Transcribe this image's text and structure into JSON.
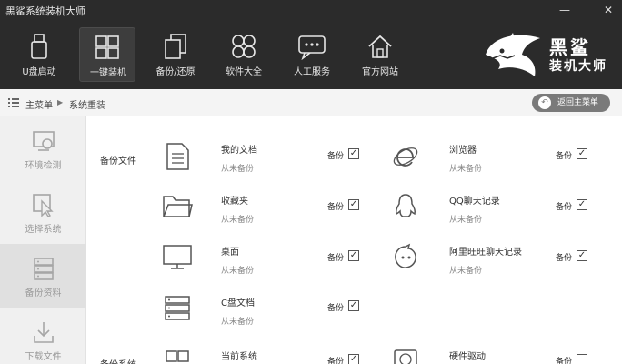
{
  "window": {
    "title": "黑鲨系统装机大师",
    "minimize_icon": "—",
    "close_icon": "✕"
  },
  "nav": [
    {
      "label": "U盘启动",
      "icon": "usb-drive-icon"
    },
    {
      "label": "一键装机",
      "icon": "windows-icon",
      "active": true
    },
    {
      "label": "备份/还原",
      "icon": "backup-restore-icon"
    },
    {
      "label": "软件大全",
      "icon": "apps-grid-icon"
    },
    {
      "label": "人工服务",
      "icon": "chat-icon"
    },
    {
      "label": "官方网站",
      "icon": "home-icon"
    }
  ],
  "logo": {
    "line1": "黑鲨",
    "line2": "装机大师",
    "icon": "shark-logo-icon"
  },
  "breadcrumb": {
    "home": "主菜单",
    "current": "系统重装",
    "separator": "▶"
  },
  "back_button": {
    "label": "返回主菜单",
    "arrow": "↶"
  },
  "sidebar": [
    {
      "label": "环境检测",
      "icon": "environment-check-icon"
    },
    {
      "label": "选择系统",
      "icon": "select-system-icon"
    },
    {
      "label": "备份资料",
      "icon": "backup-data-icon",
      "active": true
    },
    {
      "label": "下载文件",
      "icon": "download-file-icon"
    }
  ],
  "sections": {
    "backup_files": "备份文件",
    "backup_system": "备份系统"
  },
  "backup_label": "备份",
  "check_glyph": "✓",
  "items_left": [
    {
      "title": "我的文档",
      "status": "从未备份",
      "checked": true,
      "icon": "document-icon"
    },
    {
      "title": "收藏夹",
      "status": "从未备份",
      "checked": true,
      "icon": "folder-icon"
    },
    {
      "title": "桌面",
      "status": "从未备份",
      "checked": true,
      "icon": "monitor-icon"
    },
    {
      "title": "C盘文档",
      "status": "从未备份",
      "checked": true,
      "icon": "drive-stack-icon"
    },
    {
      "title": "当前系统",
      "status": "",
      "checked": true,
      "icon": "windows-icon"
    }
  ],
  "items_right": [
    {
      "title": "浏览器",
      "status": "从未备份",
      "checked": true,
      "icon": "ie-browser-icon"
    },
    {
      "title": "QQ聊天记录",
      "status": "从未备份",
      "checked": true,
      "icon": "qq-penguin-icon"
    },
    {
      "title": "阿里旺旺聊天记录",
      "status": "从未备份",
      "checked": true,
      "icon": "wangwang-icon"
    },
    {
      "title": "硬件驱动",
      "status": "",
      "checked": false,
      "icon": "hard-disk-icon"
    }
  ]
}
